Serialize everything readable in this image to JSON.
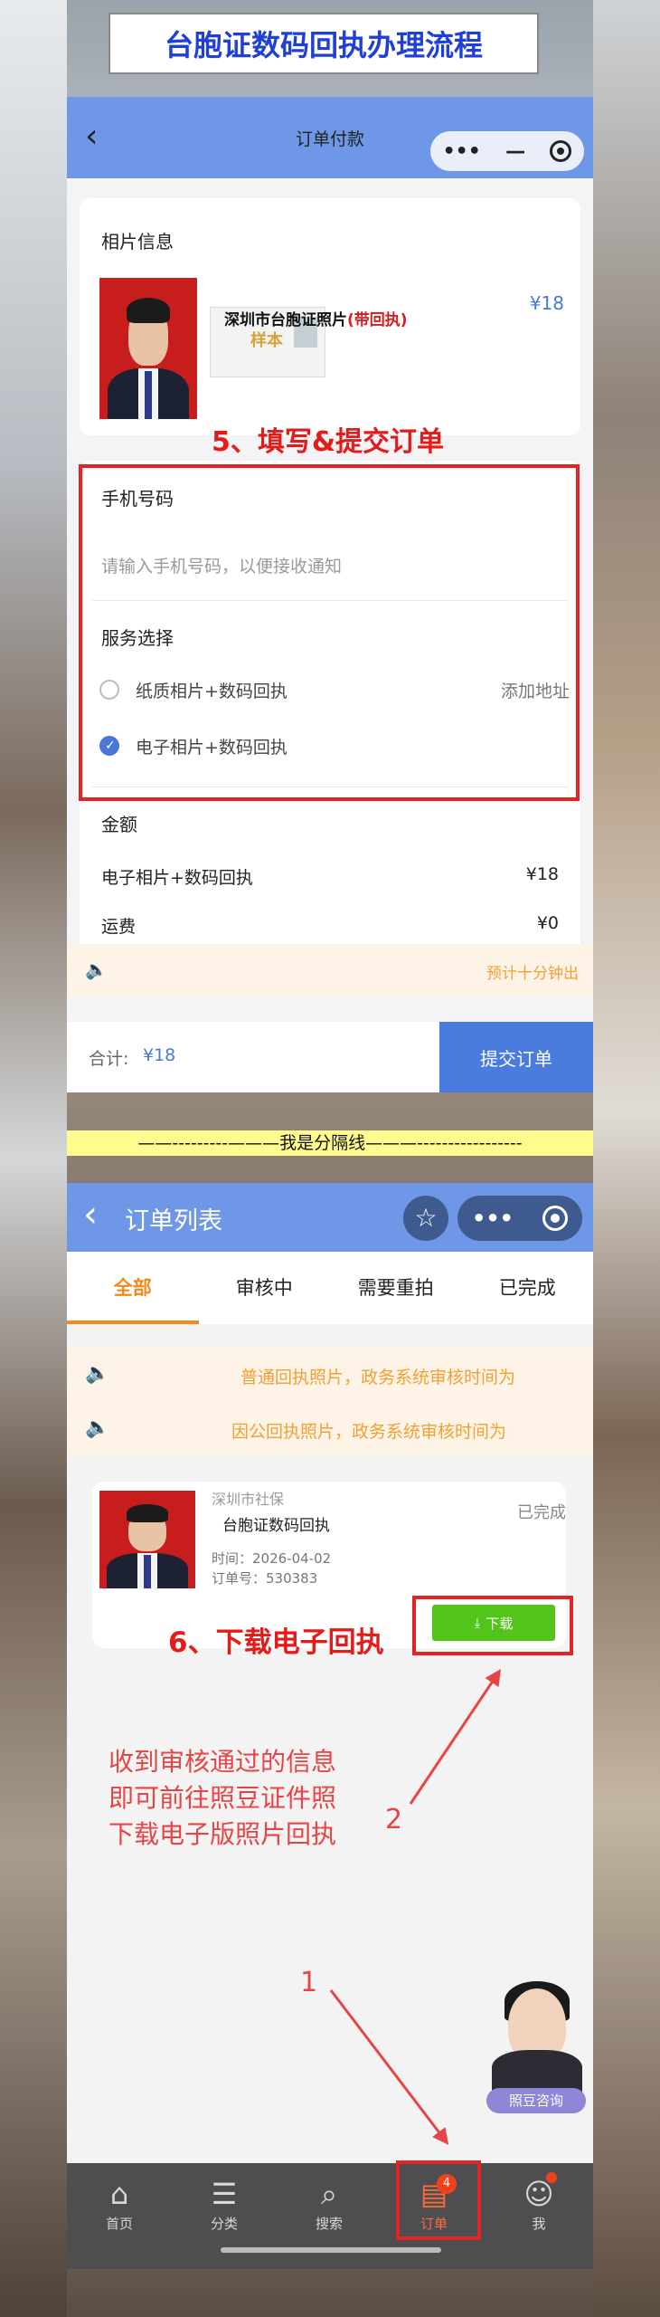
{
  "page_title": "台胞证数码回执办理流程",
  "screen1": {
    "nav_title": "订单付款",
    "photo_info_label": "相片信息",
    "product_title": "深圳市台胞证照片",
    "product_tag": "(带回执)",
    "sample_stamp": "样本",
    "price": "¥18",
    "step5": "5、填写&提交订单",
    "phone_label": "手机号码",
    "phone_placeholder": "请输入手机号码，以便接收通知",
    "service_label": "服务选择",
    "option1": "纸质相片+数码回执",
    "option1_action": "添加地址",
    "option2": "电子相片+数码回执",
    "amount_label": "金额",
    "amount_item": "电子相片+数码回执",
    "amount_item_price": "¥18",
    "shipping_label": "运费",
    "shipping_price": "¥0",
    "notice": "预计十分钟出",
    "total_label": "合计:",
    "total_value": "¥18",
    "submit": "提交订单"
  },
  "divider": "——---------———我是分隔线———-----------------",
  "screen2": {
    "nav_title": "订单列表",
    "tabs": [
      "全部",
      "审核中",
      "需要重拍",
      "已完成"
    ],
    "notice1": "普通回执照片，政务系统审核时间为",
    "notice2": "因公回执照片，政务系统审核时间为",
    "order_city": "深圳市社保",
    "order_title": "台胞证数码回执",
    "order_status": "已完成",
    "order_time": "时间：2026-04-02",
    "order_no": "订单号：530383",
    "download": "下载",
    "step6": "6、下载电子回执",
    "annotation_lines": [
      "收到审核通过的信息",
      "即可前往照豆证件照",
      "下载电子版照片回执"
    ],
    "anno_num1": "1",
    "anno_num2": "2",
    "consult": "照豆咨询",
    "tabbar": [
      {
        "label": "首页",
        "icon": "home-icon"
      },
      {
        "label": "分类",
        "icon": "category-icon"
      },
      {
        "label": "搜索",
        "icon": "search-icon"
      },
      {
        "label": "订单",
        "icon": "order-icon",
        "badge": "4"
      },
      {
        "label": "我",
        "icon": "profile-icon"
      }
    ]
  },
  "colors": {
    "nav_blue": "#6f97e8",
    "accent_blue": "#4a7ce0",
    "orange": "#f08a1c",
    "red": "#e42424",
    "green": "#52c41a"
  }
}
